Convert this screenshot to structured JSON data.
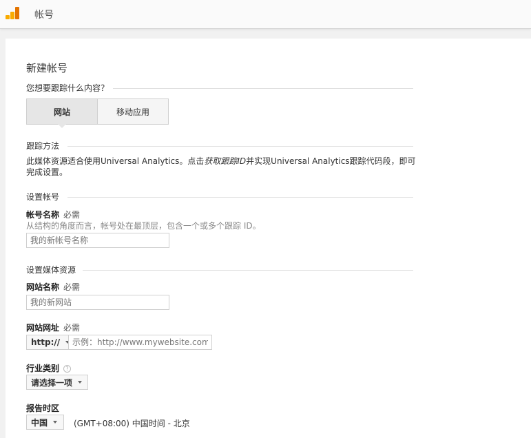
{
  "topbar": {
    "title": "帐号",
    "logo_icon": "analytics-logo-icon"
  },
  "page": {
    "title": "新建帐号",
    "track_question": "您想要跟踪什么内容？",
    "tabs": [
      {
        "label": "网站"
      },
      {
        "label": "移动应用"
      }
    ],
    "tracking_method": {
      "heading": "跟踪方法",
      "text_before": "此媒体资源适合使用Universal Analytics。点击",
      "text_em": "获取跟踪ID",
      "text_after": "并实现Universal Analytics跟踪代码段，即可完成设置。"
    },
    "account_setup": {
      "heading": "设置帐号",
      "name_label": "帐号名称",
      "required": "必需",
      "name_hint": "从结构的角度而言，帐号处在最顶层，包含一个或多个跟踪 ID。",
      "name_placeholder": "我的新帐号名称"
    },
    "property_setup": {
      "heading": "设置媒体资源",
      "site_name_label": "网站名称",
      "required": "必需",
      "site_name_placeholder": "我的新网站",
      "site_url_label": "网站网址",
      "protocol_value": "http://",
      "site_url_placeholder": "示例：http://www.mywebsite.com",
      "industry_label": "行业类别",
      "industry_value": "请选择一项",
      "timezone_label": "报告时区",
      "country_value": "中国",
      "timezone_value": "(GMT+08:00) 中国时间 - 北京"
    }
  }
}
